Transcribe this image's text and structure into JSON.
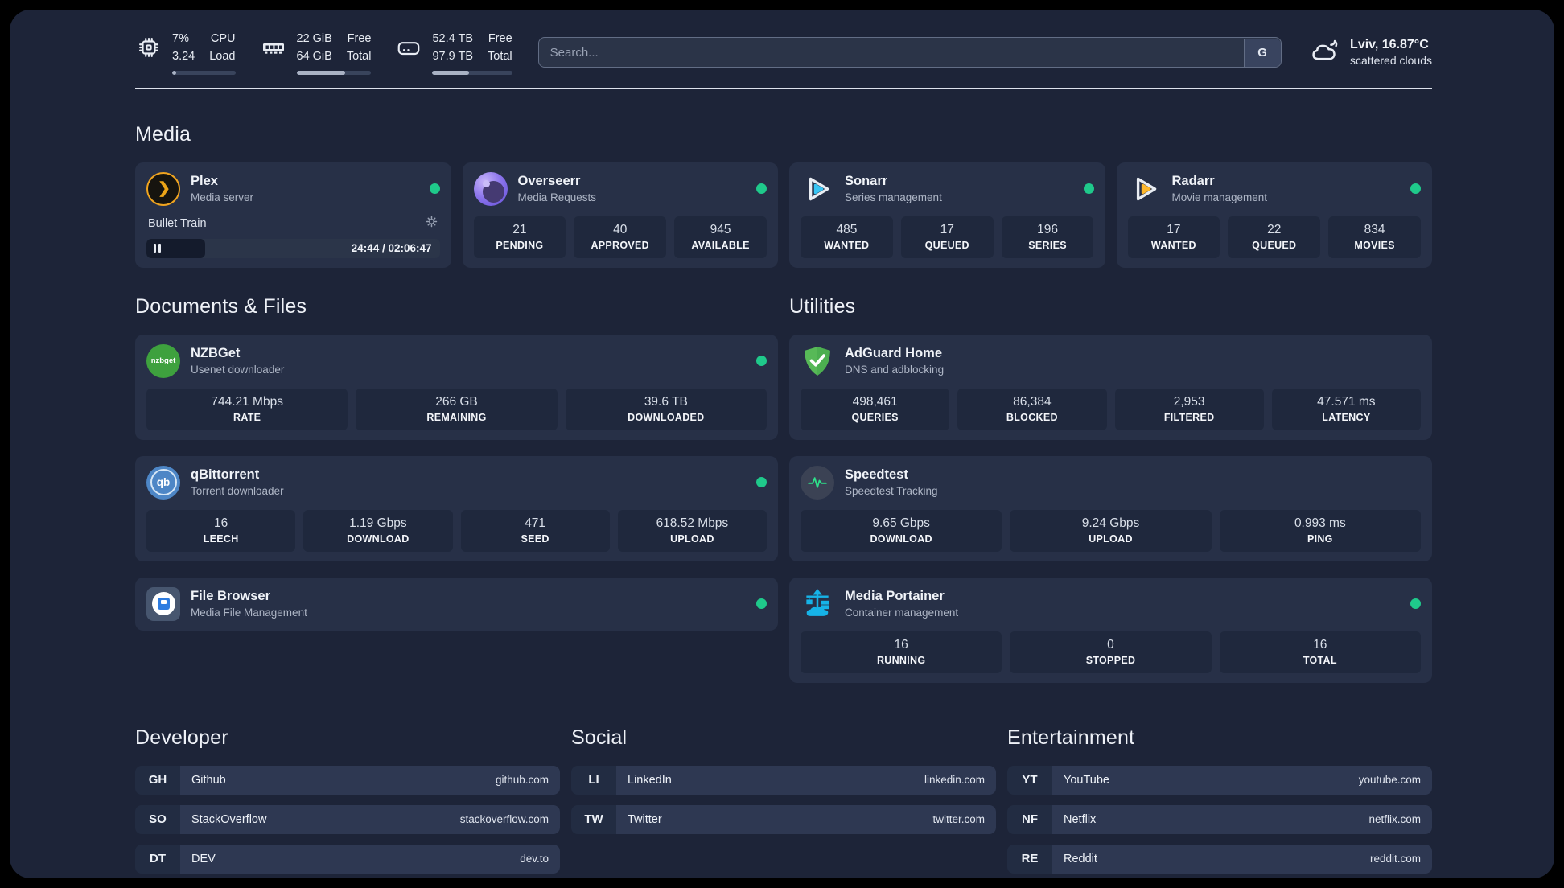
{
  "header": {
    "system_stats": [
      {
        "icon": "cpu-icon",
        "value_top": "7%",
        "value_bottom": "3.24",
        "label_top": "CPU",
        "label_bottom": "Load",
        "progress_pct": 7
      },
      {
        "icon": "memory-icon",
        "value_top": "22 GiB",
        "value_bottom": "64 GiB",
        "label_top": "Free",
        "label_bottom": "Total",
        "progress_pct": 65
      },
      {
        "icon": "disk-icon",
        "value_top": "52.4 TB",
        "value_bottom": "97.9 TB",
        "label_top": "Free",
        "label_bottom": "Total",
        "progress_pct": 46
      }
    ],
    "search": {
      "placeholder": "Search...",
      "provider_button": "G"
    },
    "weather": {
      "location_temperature": "Lviv, 16.87°C",
      "condition": "scattered clouds"
    }
  },
  "sections": {
    "media_title": "Media",
    "documents_title": "Documents & Files",
    "utilities_title": "Utilities",
    "developer_title": "Developer",
    "social_title": "Social",
    "entertainment_title": "Entertainment"
  },
  "apps": {
    "plex": {
      "name": "Plex",
      "subtitle": "Media server",
      "status": "online",
      "player": {
        "title": "Bullet Train",
        "elapsed_total": "24:44 / 02:06:47",
        "progress_pct": 20
      }
    },
    "overseerr": {
      "name": "Overseerr",
      "subtitle": "Media Requests",
      "status": "online",
      "stats": [
        {
          "value": "21",
          "label": "PENDING"
        },
        {
          "value": "40",
          "label": "APPROVED"
        },
        {
          "value": "945",
          "label": "AVAILABLE"
        }
      ]
    },
    "sonarr": {
      "name": "Sonarr",
      "subtitle": "Series management",
      "status": "online",
      "stats": [
        {
          "value": "485",
          "label": "WANTED"
        },
        {
          "value": "17",
          "label": "QUEUED"
        },
        {
          "value": "196",
          "label": "SERIES"
        }
      ]
    },
    "radarr": {
      "name": "Radarr",
      "subtitle": "Movie management",
      "status": "online",
      "stats": [
        {
          "value": "17",
          "label": "WANTED"
        },
        {
          "value": "22",
          "label": "QUEUED"
        },
        {
          "value": "834",
          "label": "MOVIES"
        }
      ]
    },
    "nzbget": {
      "name": "NZBGet",
      "subtitle": "Usenet downloader",
      "status": "online",
      "stats": [
        {
          "value": "744.21 Mbps",
          "label": "RATE"
        },
        {
          "value": "266 GB",
          "label": "REMAINING"
        },
        {
          "value": "39.6 TB",
          "label": "DOWNLOADED"
        }
      ]
    },
    "qbittorrent": {
      "name": "qBittorrent",
      "subtitle": "Torrent downloader",
      "status": "online",
      "stats": [
        {
          "value": "16",
          "label": "LEECH"
        },
        {
          "value": "1.19 Gbps",
          "label": "DOWNLOAD"
        },
        {
          "value": "471",
          "label": "SEED"
        },
        {
          "value": "618.52 Mbps",
          "label": "UPLOAD"
        }
      ]
    },
    "filebrowser": {
      "name": "File Browser",
      "subtitle": "Media File Management",
      "status": "online"
    },
    "adguard": {
      "name": "AdGuard Home",
      "subtitle": "DNS and adblocking",
      "stats": [
        {
          "value": "498,461",
          "label": "QUERIES"
        },
        {
          "value": "86,384",
          "label": "BLOCKED"
        },
        {
          "value": "2,953",
          "label": "FILTERED"
        },
        {
          "value": "47.571 ms",
          "label": "LATENCY"
        }
      ]
    },
    "speedtest": {
      "name": "Speedtest",
      "subtitle": "Speedtest Tracking",
      "stats": [
        {
          "value": "9.65 Gbps",
          "label": "DOWNLOAD"
        },
        {
          "value": "9.24 Gbps",
          "label": "UPLOAD"
        },
        {
          "value": "0.993 ms",
          "label": "PING"
        }
      ]
    },
    "portainer": {
      "name": "Media Portainer",
      "subtitle": "Container management",
      "status": "online",
      "stats": [
        {
          "value": "16",
          "label": "RUNNING"
        },
        {
          "value": "0",
          "label": "STOPPED"
        },
        {
          "value": "16",
          "label": "TOTAL"
        }
      ]
    }
  },
  "bookmarks": {
    "developer": [
      {
        "abbr": "GH",
        "name": "Github",
        "url": "github.com"
      },
      {
        "abbr": "SO",
        "name": "StackOverflow",
        "url": "stackoverflow.com"
      },
      {
        "abbr": "DT",
        "name": "DEV",
        "url": "dev.to"
      }
    ],
    "social": [
      {
        "abbr": "LI",
        "name": "LinkedIn",
        "url": "linkedin.com"
      },
      {
        "abbr": "TW",
        "name": "Twitter",
        "url": "twitter.com"
      }
    ],
    "entertainment": [
      {
        "abbr": "YT",
        "name": "YouTube",
        "url": "youtube.com"
      },
      {
        "abbr": "NF",
        "name": "Netflix",
        "url": "netflix.com"
      },
      {
        "abbr": "RE",
        "name": "Reddit",
        "url": "reddit.com"
      }
    ]
  },
  "icon_text": {
    "plex_chevron": "❯",
    "nzbget_logo": "nzbget",
    "qbittorrent_logo": "qb"
  },
  "colors": {
    "status_online": "#1fc98b",
    "panel_bg": "#1d2438",
    "card_bg": "#273047",
    "stat_bg": "#1f283d",
    "accent_plex": "#eca417",
    "accent_sonarr": "#38c5f4",
    "accent_radarr": "#fdb72c",
    "accent_adguard": "#57b957",
    "accent_portainer": "#16b3e8",
    "accent_speedtest": "#2ee08a"
  }
}
